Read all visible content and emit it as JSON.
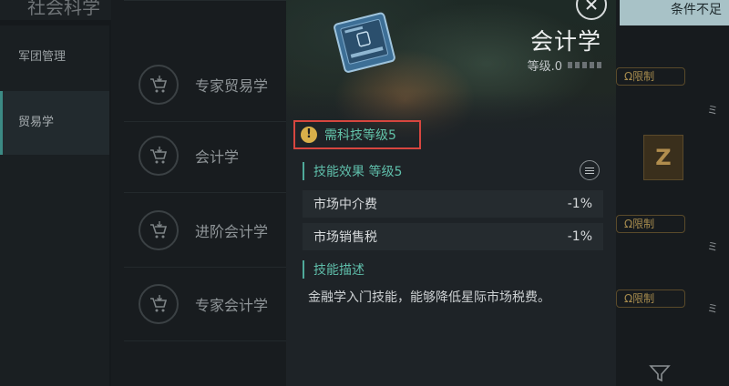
{
  "background": {
    "section_title": "社会科学",
    "nav_items": [
      {
        "label": "军团管理",
        "active": false
      },
      {
        "label": "贸易学",
        "active": true
      }
    ],
    "skill_list": [
      {
        "label": "专家贸易学"
      },
      {
        "label": "会计学"
      },
      {
        "label": "进阶会计学"
      },
      {
        "label": "专家会计学"
      }
    ],
    "condition_text": "条件不足",
    "limit_tags": [
      "Ω限制",
      "Ω限制",
      "Ω限制"
    ],
    "z_tile_letter": "Z",
    "edge_glyphs": [
      "ミ",
      "ミ",
      "ミ"
    ]
  },
  "modal": {
    "icon": "skillbook-card-icon",
    "title": "会计学",
    "level_text": "等级.0",
    "level_pips": 5,
    "requirement_text": "需科技等级5",
    "effects_heading": "技能效果 等级5",
    "effects": [
      {
        "name": "市场中介费",
        "value": "-1%"
      },
      {
        "name": "市场销售税",
        "value": "-1%"
      }
    ],
    "description_heading": "技能描述",
    "description": "金融学入门技能，能够降低星际市场税费。"
  },
  "colors": {
    "accent_teal": "#5fbeaa",
    "highlight_red": "#d7463f",
    "warning_yellow": "#d8b04a"
  }
}
